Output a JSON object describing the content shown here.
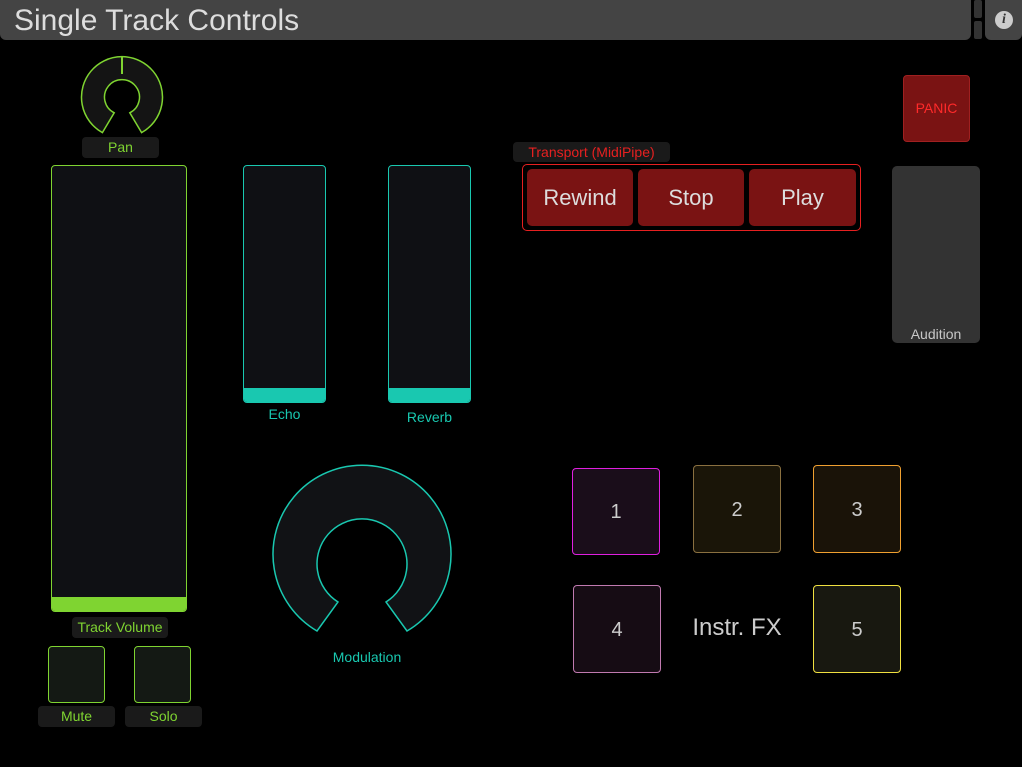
{
  "header": {
    "title": "Single Track Controls"
  },
  "pan": {
    "label": "Pan",
    "value": 0.5
  },
  "track_volume": {
    "label": "Track Volume",
    "value": 0
  },
  "mute": {
    "label": "Mute"
  },
  "solo": {
    "label": "Solo"
  },
  "echo": {
    "label": "Echo",
    "value": 0
  },
  "reverb": {
    "label": "Reverb",
    "value": 0
  },
  "modulation": {
    "label": "Modulation",
    "value": 0
  },
  "transport": {
    "label": "Transport (MidiPipe)",
    "rewind": "Rewind",
    "stop": "Stop",
    "play": "Play"
  },
  "panic": {
    "label": "PANIC"
  },
  "audition": {
    "label": "Audition"
  },
  "instr_fx": {
    "label": "Instr. FX",
    "pads": [
      "1",
      "2",
      "3",
      "4",
      "5"
    ]
  },
  "colors": {
    "green": "#7fd431",
    "teal": "#19c8b0",
    "red": "#e62020",
    "magenta": "#e020e0",
    "brown": "#8a7040",
    "orange": "#f0a030",
    "pink": "#c07ab0",
    "yellow": "#f0e040"
  }
}
